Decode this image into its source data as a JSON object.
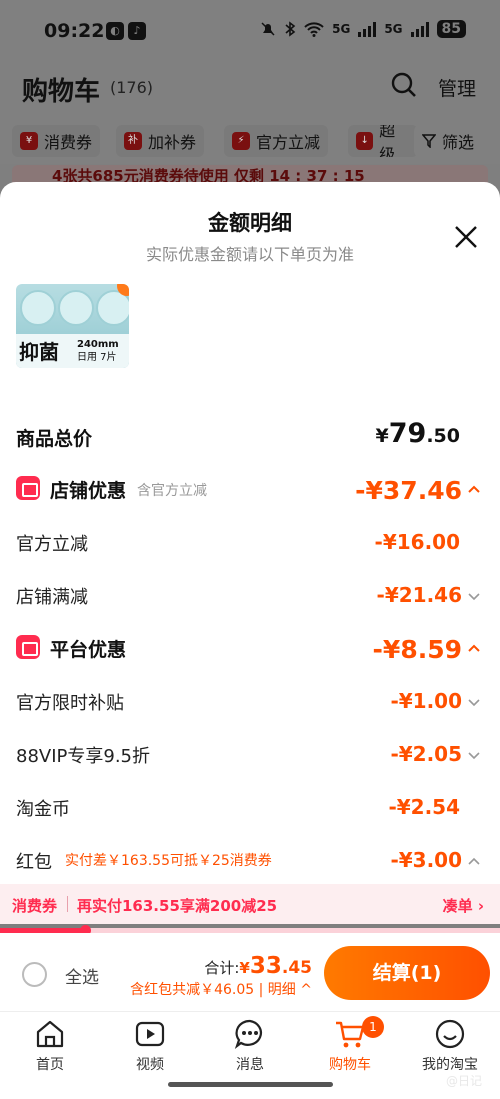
{
  "status": {
    "time": "09:22",
    "battery": "85",
    "net": "5G"
  },
  "header": {
    "title": "购物车",
    "count": "(176)",
    "manage": "管理"
  },
  "filters": [
    "消费券",
    "加补券",
    "官方立减",
    "超级",
    "筛选"
  ],
  "filter_icons": [
    "¥",
    "补",
    "⚡",
    "↓"
  ],
  "coupon_strip": "4张共685元消费券待使用  仅剩 14 : 37 : 15",
  "sheet": {
    "title": "金额明细",
    "subtitle": "实际优惠金额请以下单页为准"
  },
  "product": {
    "thumb_big": "抑菌",
    "thumb_small": "240mm",
    "thumb_small2": "日用 7片"
  },
  "total": {
    "label": "商品总价",
    "yen": "¥",
    "int": "79",
    "dec": ".50"
  },
  "shop": {
    "label": "店铺优惠",
    "note": "含官方立减",
    "amount": "-¥37.46",
    "items": [
      {
        "label": "官方立减",
        "amount": "-¥16.00"
      },
      {
        "label": "店铺满减",
        "amount": "-¥21.46"
      }
    ]
  },
  "platform": {
    "label": "平台优惠",
    "amount": "-¥8.59",
    "items": [
      {
        "label": "官方限时补贴",
        "amount": "-¥1.00"
      },
      {
        "label": "88VIP专享9.5折",
        "amount": "-¥2.05"
      },
      {
        "label": "淘金币",
        "amount": "-¥2.54"
      },
      {
        "label": "红包",
        "note": "实付差￥163.55可抵￥25消费券",
        "amount": "-¥3.00"
      }
    ]
  },
  "promo": {
    "tag": "消费券",
    "text": "再实付163.55享满200减25",
    "link": "凑单 ›",
    "progress": 0.17
  },
  "checkout": {
    "select_all": "全选",
    "sum_label": "合计:",
    "sum_yen": "¥",
    "sum_int": "33",
    "sum_dec": ".45",
    "sub": "含红包共减￥46.05 | 明细 ^",
    "button": "结算(1)"
  },
  "tabs": [
    {
      "label": "首页",
      "icon": "home-icon"
    },
    {
      "label": "视频",
      "icon": "video-icon"
    },
    {
      "label": "消息",
      "icon": "message-icon"
    },
    {
      "label": "购物车",
      "icon": "cart-icon",
      "badge": "1"
    },
    {
      "label": "我的淘宝",
      "icon": "profile-icon"
    }
  ],
  "watermark": "@日记",
  "colors": {
    "accent": "#ff5000",
    "red": "#ff2c4f",
    "dim": "#808080"
  }
}
